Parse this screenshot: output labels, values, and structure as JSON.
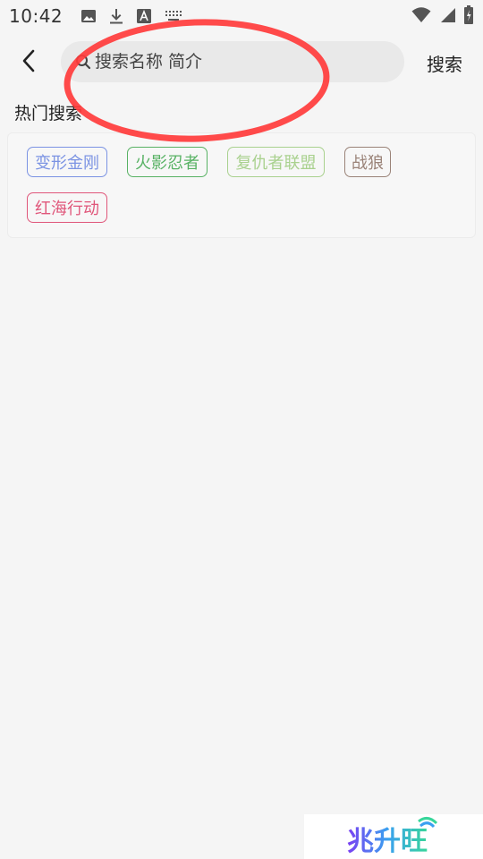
{
  "status_bar": {
    "time": "10:42",
    "icons_left": [
      "image-icon",
      "download-icon",
      "font-icon",
      "keyboard-icon"
    ],
    "icons_right": [
      "wifi-icon",
      "signal-icon",
      "battery-icon"
    ]
  },
  "header": {
    "back_icon": "chevron-left-icon",
    "search_placeholder": "搜索名称 简介",
    "search_value": "",
    "search_button_label": "搜索"
  },
  "hot_search": {
    "title": "热门搜索",
    "tags": [
      {
        "label": "变形金刚",
        "color": "#7b93e3"
      },
      {
        "label": "火影忍者",
        "color": "#58b264"
      },
      {
        "label": "复仇者联盟",
        "color": "#a9d18e"
      },
      {
        "label": "战狼",
        "color": "#9a8378"
      },
      {
        "label": "红海行动",
        "color": "#e0567a"
      }
    ]
  },
  "annotation": {
    "color": "#ff3b3b"
  },
  "watermark": {
    "text": "兆升旺"
  }
}
